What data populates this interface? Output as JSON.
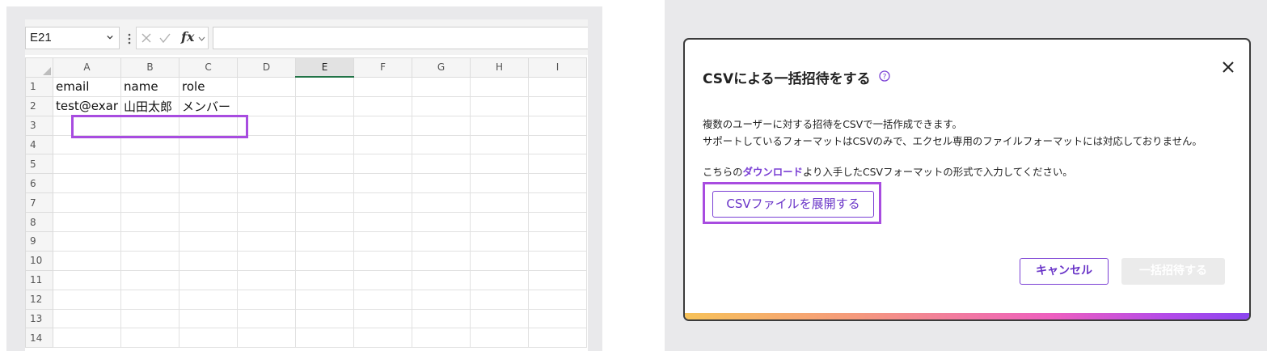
{
  "spreadsheet": {
    "name_box": "E21",
    "column_headers": [
      "A",
      "B",
      "C",
      "D",
      "E",
      "F",
      "G",
      "H",
      "I"
    ],
    "selected_column": "E",
    "rows": [
      {
        "num": "1",
        "cells": [
          "email",
          "name",
          "role",
          "",
          "",
          "",
          "",
          "",
          ""
        ]
      },
      {
        "num": "2",
        "cells": [
          "test@exar",
          "山田太郎",
          "メンバー",
          "",
          "",
          "",
          "",
          "",
          ""
        ]
      },
      {
        "num": "3",
        "cells": [
          "",
          "",
          "",
          "",
          "",
          "",
          "",
          "",
          ""
        ]
      },
      {
        "num": "4",
        "cells": [
          "",
          "",
          "",
          "",
          "",
          "",
          "",
          "",
          ""
        ]
      },
      {
        "num": "5",
        "cells": [
          "",
          "",
          "",
          "",
          "",
          "",
          "",
          "",
          ""
        ]
      },
      {
        "num": "6",
        "cells": [
          "",
          "",
          "",
          "",
          "",
          "",
          "",
          "",
          ""
        ]
      },
      {
        "num": "7",
        "cells": [
          "",
          "",
          "",
          "",
          "",
          "",
          "",
          "",
          ""
        ]
      },
      {
        "num": "8",
        "cells": [
          "",
          "",
          "",
          "",
          "",
          "",
          "",
          "",
          ""
        ]
      },
      {
        "num": "9",
        "cells": [
          "",
          "",
          "",
          "",
          "",
          "",
          "",
          "",
          ""
        ]
      },
      {
        "num": "10",
        "cells": [
          "",
          "",
          "",
          "",
          "",
          "",
          "",
          "",
          ""
        ]
      },
      {
        "num": "11",
        "cells": [
          "",
          "",
          "",
          "",
          "",
          "",
          "",
          "",
          ""
        ]
      },
      {
        "num": "12",
        "cells": [
          "",
          "",
          "",
          "",
          "",
          "",
          "",
          "",
          ""
        ]
      },
      {
        "num": "13",
        "cells": [
          "",
          "",
          "",
          "",
          "",
          "",
          "",
          "",
          ""
        ]
      },
      {
        "num": "14",
        "cells": [
          "",
          "",
          "",
          "",
          "",
          "",
          "",
          "",
          ""
        ]
      }
    ],
    "fx_label": "fx"
  },
  "dialog": {
    "title": "CSVによる一括招待をする",
    "desc_line1": "複数のユーザーに対する招待をCSVで一括作成できます。",
    "desc_line2": "サポートしているフォーマットはCSVのみで、エクセル専用のファイルフォーマットには対応しておりません。",
    "desc_line3_prefix": "こちらの",
    "download_link": "ダウンロード",
    "desc_line3_suffix": "より入手したCSVフォーマットの形式で入力してください。",
    "expand_button": "CSVファイルを展開する",
    "cancel_button": "キャンセル",
    "invite_button": "一括招待する"
  },
  "colors": {
    "accent": "#7a3fd4",
    "highlight": "#a84ce0",
    "excel_green": "#217346"
  }
}
